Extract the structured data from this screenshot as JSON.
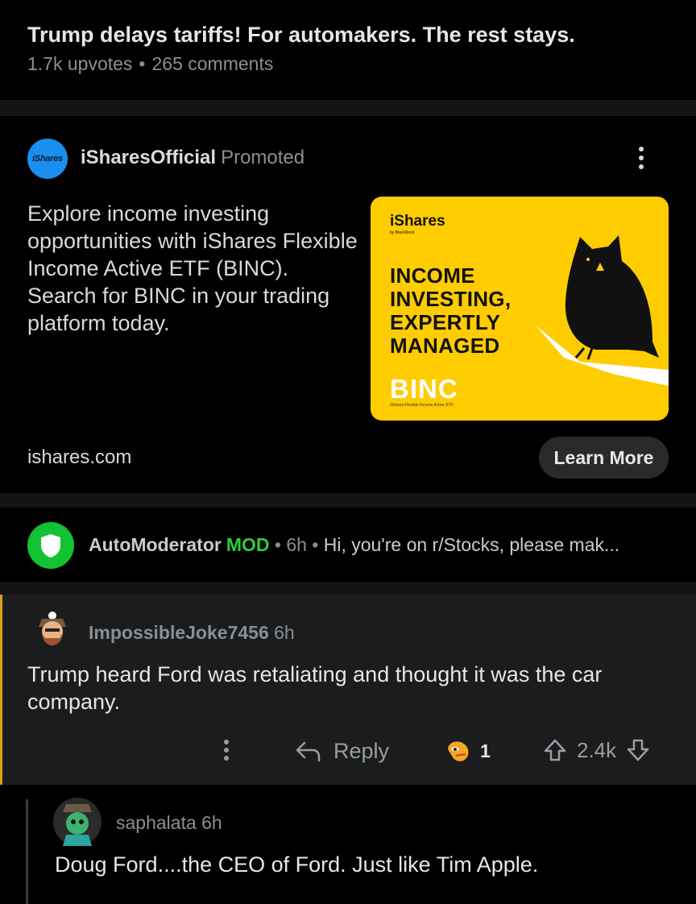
{
  "post": {
    "title": "Trump delays tariffs! For automakers. The rest stays.",
    "upvotes": "1.7k upvotes",
    "separator": "•",
    "comments": "265 comments"
  },
  "ad": {
    "avatar_text": "iShares",
    "advertiser": "iSharesOfficial",
    "promoted": "Promoted",
    "text": "Explore income investing opportunities with iShares Flexible Income Active ETF (BINC). Search for BINC in your trading platform today.",
    "image": {
      "brand": "iShares",
      "brand_sub": "by BlackRock",
      "headline_lines": [
        "INCOME",
        "INVESTING,",
        "EXPERTLY",
        "MANAGED"
      ],
      "ticker": "BINC",
      "ticker_sub": "iShares Flexible Income Active ETF"
    },
    "domain": "ishares.com",
    "cta": "Learn More"
  },
  "automod": {
    "name": "AutoModerator",
    "badge": "MOD",
    "time": "• 6h •",
    "snippet": "Hi, you're on r/Stocks, please mak..."
  },
  "comment1": {
    "user": "ImpossibleJoke7456",
    "time": "6h",
    "body": "Trump heard Ford was retaliating and thought it was the car company.",
    "reply_label": "Reply",
    "award_count": "1",
    "score": "2.4k"
  },
  "comment2": {
    "user": "saphalata",
    "time": "6h",
    "body": "Doug Ford....the CEO of Ford. Just like Tim Apple."
  },
  "colors": {
    "background": "#000000",
    "accent_mod": "#2ecc40",
    "ad_yellow": "#ffcc00",
    "ishares_blue": "#1b8ff0",
    "comment_highlight": "#1a1c1e"
  }
}
